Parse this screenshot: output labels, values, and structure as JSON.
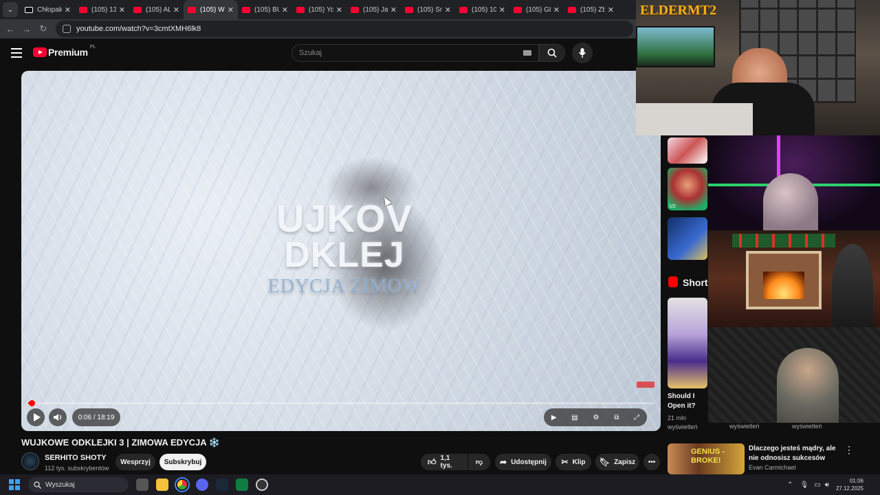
{
  "browser": {
    "tabs": [
      {
        "label": "Chłopaki",
        "favicon": "tiktok-icon"
      },
      {
        "label": "(105) 13",
        "favicon": "youtube-icon"
      },
      {
        "label": "(105) AL",
        "favicon": "youtube-icon"
      },
      {
        "label": "(105) W",
        "favicon": "youtube-icon",
        "active": true
      },
      {
        "label": "(105) BU",
        "favicon": "youtube-icon"
      },
      {
        "label": "(105) Yo",
        "favicon": "youtube-icon"
      },
      {
        "label": "(105) Jal",
        "favicon": "youtube-icon"
      },
      {
        "label": "(105) Sm",
        "favicon": "youtube-icon"
      },
      {
        "label": "(105) 10",
        "favicon": "youtube-icon"
      },
      {
        "label": "(105) GL",
        "favicon": "youtube-icon"
      },
      {
        "label": "(105) Zb",
        "favicon": "youtube-icon"
      }
    ],
    "url": "youtube.com/watch?v=3cmtXMH6lk8"
  },
  "youtube": {
    "logo_text": "Premium",
    "country_code": "PL",
    "search_placeholder": "Szukaj"
  },
  "player": {
    "overlay_line1": "UJKOV",
    "overlay_line2": "DKLEJ",
    "overlay_line3": "EDYCJA ZIMOW",
    "time": "0:06 / 18:19",
    "progress_fraction": 0.0055
  },
  "video": {
    "title": "WUJKOWE ODKLEJKI 3 | ZIMOWA EDYCJA ❄️",
    "channel": "SERHITO SHOTY",
    "subscribers": "112 tys. subskrybentów",
    "support_label": "Wesprzyj",
    "subscribe_label": "Subskrybuj",
    "likes": "1,1 tys.",
    "share_label": "Udostępnij",
    "clip_label": "Klip",
    "save_label": "Zapisz"
  },
  "sidebar": {
    "shorts_label": "Shorts",
    "short_title": "Should I Open it? Or...",
    "short_views": "21 mln wyświetleń",
    "views_label_2": "wyświetleń",
    "views_label_3": "wyświetleń",
    "badge": "1/2",
    "rec_title": "Dlaczego jesteś mądry, ale nie odnosisz sukcesów",
    "rec_channel": "Evan Carmichael",
    "rec_thumb_text": "GENIUS - BROKE!"
  },
  "overlay": {
    "streamer_logo": "ELDERMT2"
  },
  "taskbar": {
    "search_label": "Wyszukaj",
    "time": "01:06",
    "date": "27.12.2025"
  },
  "colors": {
    "yt_red": "#ff0033",
    "accent_blue": "#3ea2f5"
  }
}
